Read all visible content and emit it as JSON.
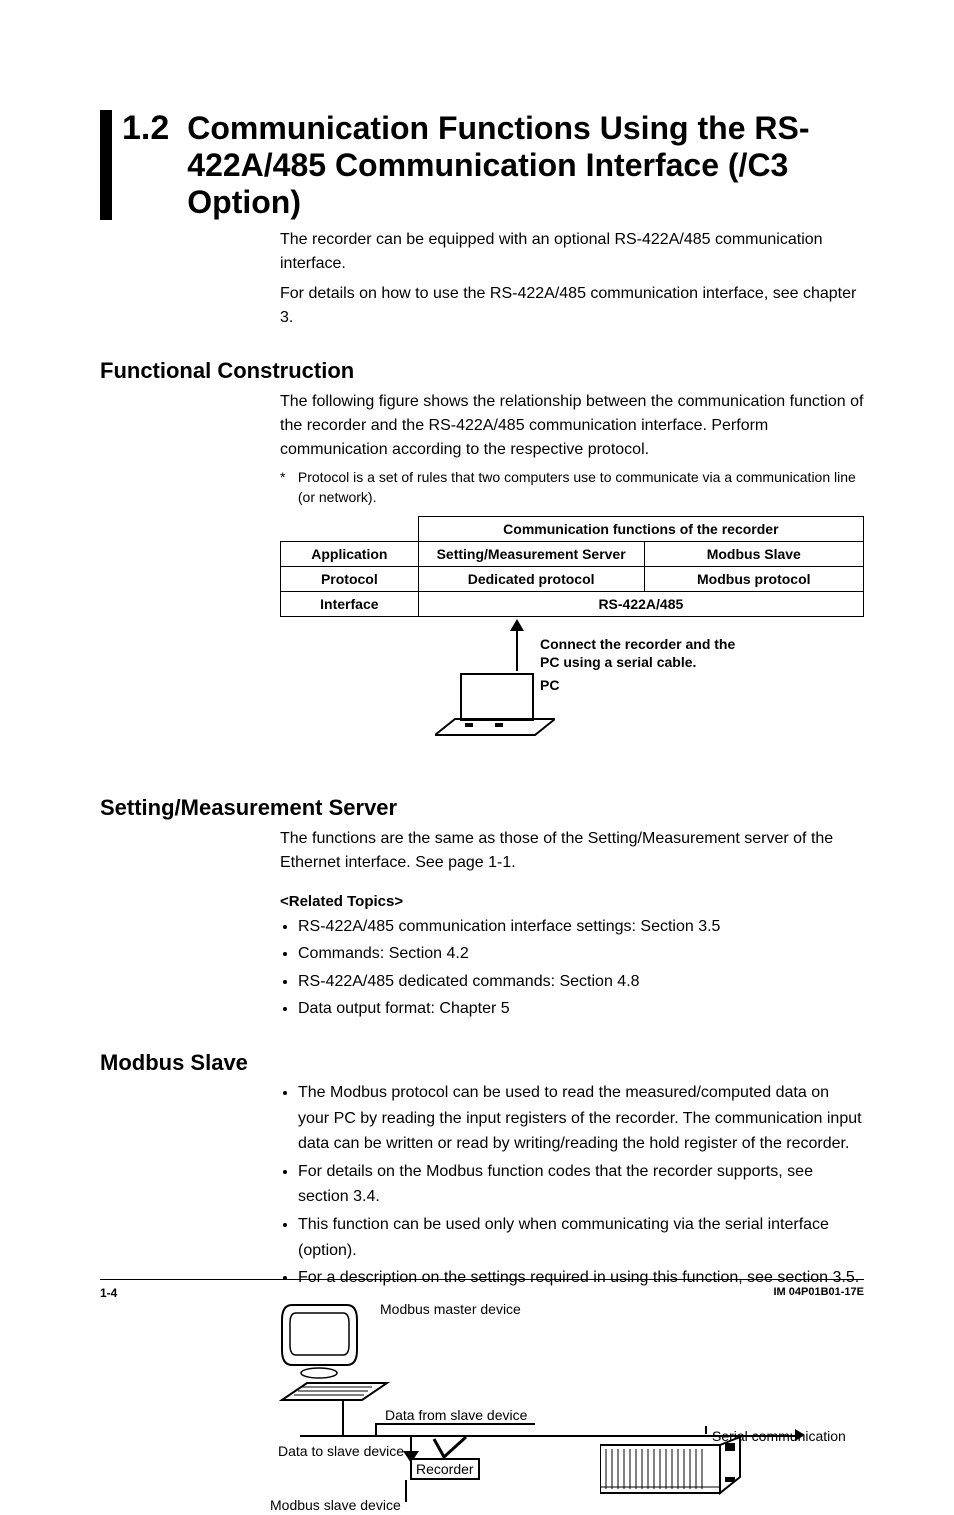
{
  "section_number": "1.2",
  "section_title": "Communication Functions Using the RS-422A/485 Communication Interface (/C3 Option)",
  "intro_p1": "The recorder can be equipped with an optional RS-422A/485 communication interface.",
  "intro_p2": "For details on how to use the RS-422A/485 communication interface, see chapter 3.",
  "h2_functional": "Functional Construction",
  "func_body": "The following figure shows the relationship between the communication function of the recorder and the RS-422A/485 communication interface. Perform communication according to the respective protocol.",
  "footnote_star": "*",
  "footnote": "Protocol is a set of rules that two computers use to communicate via a communication line (or network).",
  "table": {
    "header_span": "Communication functions of the recorder",
    "rows": [
      {
        "label": "Application",
        "a": "Setting/Measurement Server",
        "b": "Modbus Slave"
      },
      {
        "label": "Protocol",
        "a": "Dedicated protocol",
        "b": "Modbus protocol"
      },
      {
        "label": "Interface",
        "span": "RS-422A/485"
      }
    ]
  },
  "diag1": {
    "connect_l1": "Connect the recorder and the",
    "connect_l2": "PC using a serial cable.",
    "pc": "PC"
  },
  "h2_setting": "Setting/Measurement Server",
  "setting_body": "The functions are the same as those of the Setting/Measurement server of the Ethernet interface. See page 1-1.",
  "related_hd": "<Related Topics>",
  "related": [
    "RS-422A/485 communication interface settings: Section 3.5",
    "Commands: Section 4.2",
    "RS-422A/485 dedicated commands: Section 4.8",
    "Data output format: Chapter 5"
  ],
  "h2_modbus": "Modbus Slave",
  "modbus_bullets": [
    "The Modbus protocol can be used to read the measured/computed data on your PC by reading the input registers of the recorder. The communication input data can be written or read by writing/reading the hold register of the recorder.",
    "For details on the Modbus function codes that the recorder supports, see section 3.4.",
    "This function can be used only when communicating via the serial interface (option).",
    "For a description on the settings required in using this function, see section 3.5."
  ],
  "diag2": {
    "master": "Modbus master device",
    "from_slave": "Data from slave device",
    "to_slave": "Data to slave device",
    "serial": "Serial communication",
    "recorder": "Recorder",
    "slave": "Modbus slave device"
  },
  "footer_left": "1-4",
  "footer_right": "IM 04P01B01-17E"
}
